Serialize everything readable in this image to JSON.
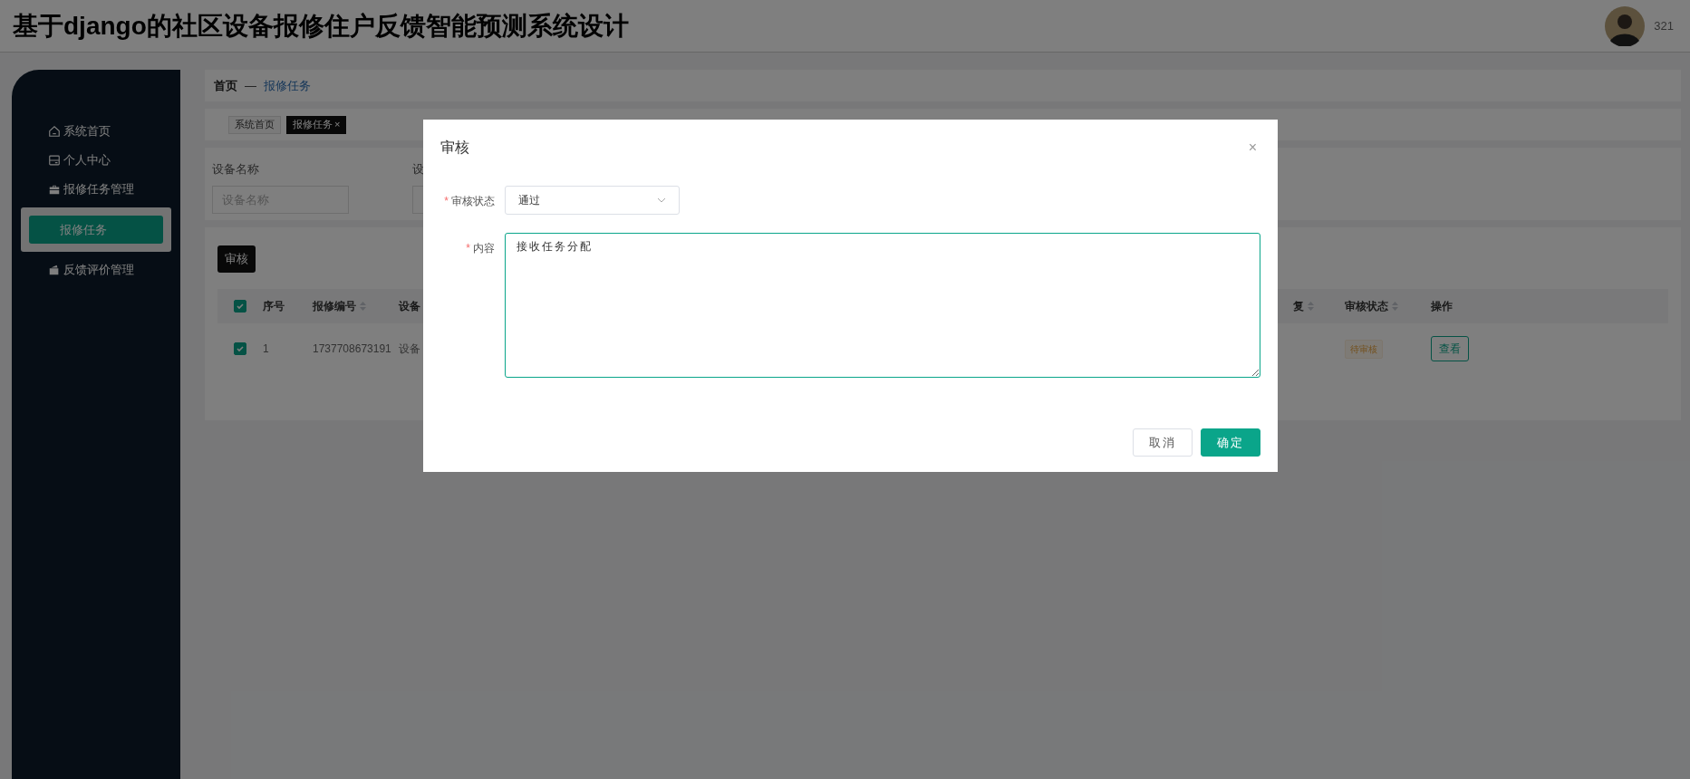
{
  "header": {
    "title": "基于django的社区设备报修住户反馈智能预测系统设计",
    "user": "321"
  },
  "sidebar": {
    "items": [
      {
        "label": "系统首页"
      },
      {
        "label": "个人中心"
      },
      {
        "label": "报修任务管理",
        "children": [
          {
            "label": "报修任务",
            "selected": true
          }
        ]
      },
      {
        "label": "反馈评价管理"
      }
    ]
  },
  "breadcrumb": {
    "items": [
      "首页",
      "报修任务"
    ],
    "separator": "—"
  },
  "tabs": [
    {
      "label": "系统首页",
      "selected": false
    },
    {
      "label": "报修任务",
      "selected": true,
      "close": "×"
    }
  ],
  "search": {
    "fields": [
      {
        "label": "设备名称",
        "placeholder": "设备名称"
      },
      {
        "label": "设"
      }
    ]
  },
  "toolbar": {
    "buttons": [
      "审核"
    ]
  },
  "table": {
    "header_checked": true,
    "columns": [
      {
        "label": "序号",
        "sortable": false
      },
      {
        "label": "报修编号",
        "sortable": true
      },
      {
        "label": "设备"
      },
      {
        "label": "复",
        "sortable": true
      },
      {
        "label": "审核状态",
        "sortable": true
      },
      {
        "label": "操作",
        "sortable": false
      }
    ],
    "rows": [
      {
        "checked": true,
        "index": "1",
        "number": "1737708673191",
        "device": "设备",
        "status": "待审核",
        "action": "查看"
      }
    ]
  },
  "dialog": {
    "title": "审核",
    "close": "×",
    "required_marker": "*",
    "fields": [
      {
        "kind": "select",
        "label": "审核状态",
        "required": true,
        "value": "通过"
      },
      {
        "kind": "textarea",
        "label": "内容",
        "required": true,
        "value": "接收任务分配"
      }
    ],
    "buttons": [
      {
        "label": "取消",
        "primary": false
      },
      {
        "label": "确定",
        "primary": true
      }
    ]
  }
}
